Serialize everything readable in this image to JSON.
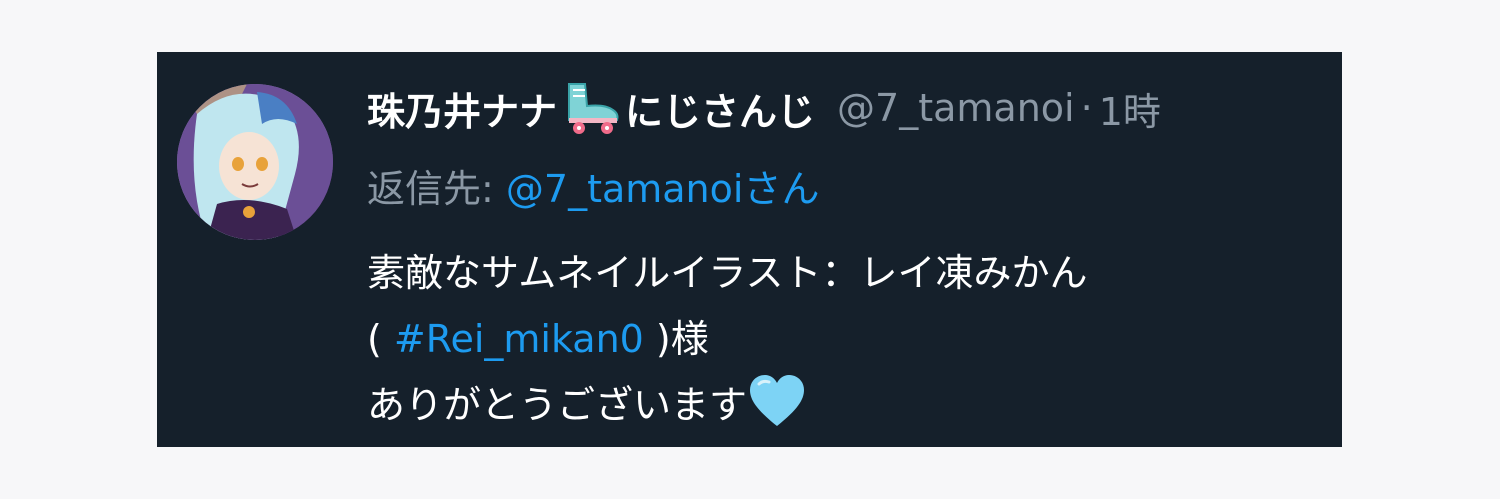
{
  "tweet": {
    "display_name": "珠乃井ナナ",
    "display_name_suffix": "にじさんじ",
    "name_icon": "roller-skate-icon",
    "handle": "@7_tamanoi",
    "separator": "·",
    "time": "1時",
    "reply": {
      "label": "返信先: ",
      "mention": "@7_tamanoi",
      "suffix": "さん"
    },
    "body": {
      "line1": "素敵なサムネイルイラスト：レイ凍みかん",
      "line2_prefix": "( ",
      "hashtag": "#Rei_mikan0",
      "line2_suffix": " )様",
      "line3": "ありがとうございます",
      "end_icon": "light-blue-heart-icon"
    }
  },
  "colors": {
    "card_background": "#15202b",
    "page_background": "#f7f7f9",
    "primary_text": "#ffffff",
    "secondary_text": "#8b98a5",
    "link": "#1d9bf0",
    "heart": "#7dd3f5"
  }
}
